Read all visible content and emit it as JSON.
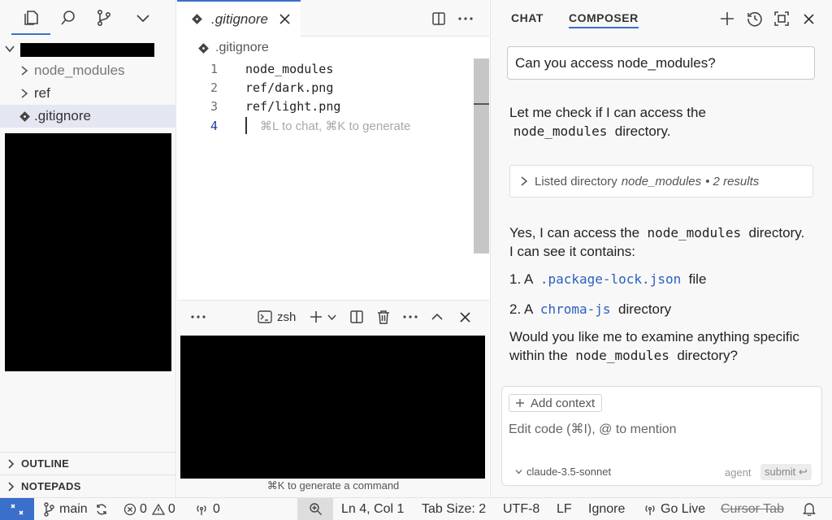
{
  "sidebar": {
    "tree": [
      {
        "label": "node_modules",
        "muted": true
      },
      {
        "label": "ref",
        "muted": false
      },
      {
        "label": ".gitignore",
        "selected": true
      }
    ],
    "sections": [
      {
        "label": "OUTLINE"
      },
      {
        "label": "NOTEPADS"
      }
    ]
  },
  "editor": {
    "tab_label": ".gitignore",
    "breadcrumb": ".gitignore",
    "line_numbers": [
      "1",
      "2",
      "3",
      "4"
    ],
    "lines": [
      "node_modules",
      "ref/dark.png",
      "ref/light.png"
    ],
    "cursor_hint": "⌘L to chat, ⌘K to generate"
  },
  "terminal": {
    "shell_label": "zsh",
    "hint": "⌘K to generate a command"
  },
  "composer": {
    "tabs": [
      "CHAT",
      "COMPOSER"
    ],
    "question": "Can you access node_modules?",
    "msg1_pre": "Let me check if I can access the",
    "msg1_code": "node_modules",
    "msg1_post": "directory.",
    "tool_label": "Listed directory",
    "tool_target": "node_modules",
    "tool_results": "• 2 results",
    "msg2_a": "Yes, I can access the",
    "msg2_code": "node_modules",
    "msg2_b": "directory.",
    "msg2_c": "I can see it contains:",
    "item1_num": "1. A",
    "item1_code": ".package-lock.json",
    "item1_post": "file",
    "item2_num": "2. A",
    "item2_code": "chroma-js",
    "item2_post": "directory",
    "msg3_a": "Would you like me to examine anything specific",
    "msg3_b": "within the",
    "msg3_code": "node_modules",
    "msg3_c": "directory?",
    "add_context": "Add context",
    "input_placeholder": "Edit code (⌘I), @ to mention",
    "model": "claude-3.5-sonnet",
    "mode": "agent",
    "submit": "submit ↩"
  },
  "statusbar": {
    "branch": "main",
    "errors": "0",
    "warnings": "0",
    "ports": "0",
    "position": "Ln 4, Col 1",
    "tab_size": "Tab Size: 2",
    "encoding": "UTF-8",
    "eol": "LF",
    "language": "Ignore",
    "go_live": "Go Live",
    "cursor_tab": "Cursor Tab"
  },
  "colors": {
    "accent": "#3a6fcb",
    "code_blue": "#2b5fbd"
  }
}
